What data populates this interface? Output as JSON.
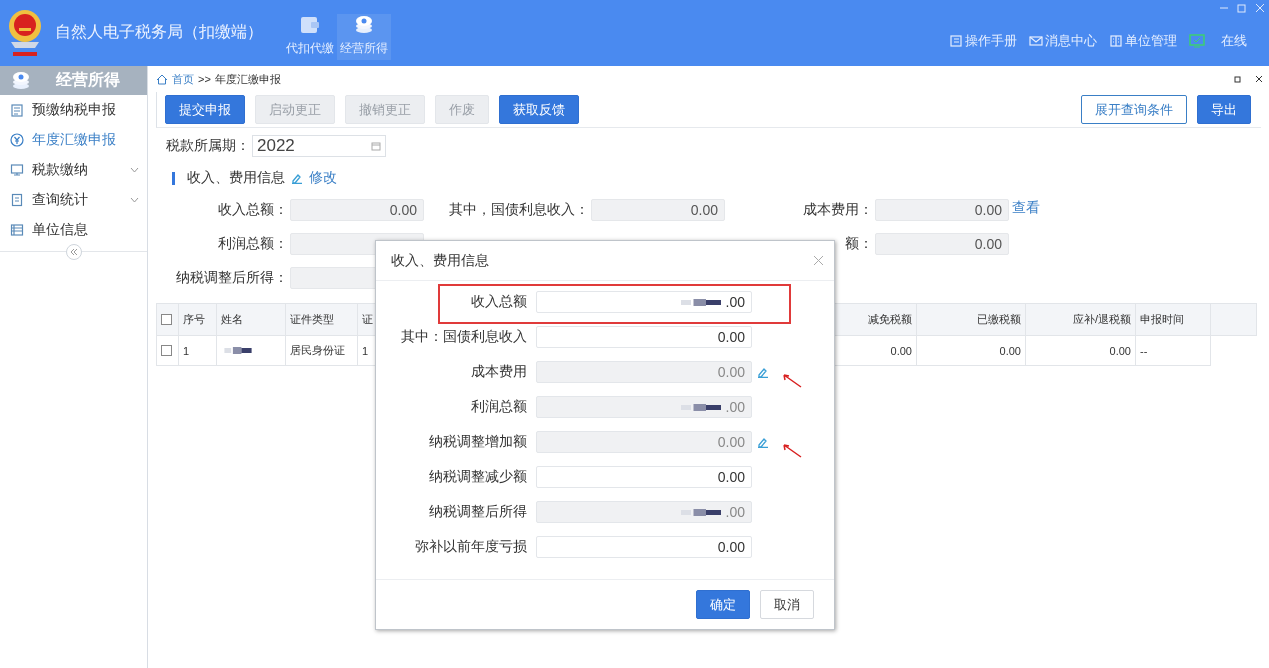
{
  "header": {
    "title": "自然人电子税务局（扣缴端）",
    "nav": [
      {
        "label": "代扣代缴",
        "selected": false
      },
      {
        "label": "经营所得",
        "selected": true
      }
    ],
    "links": [
      {
        "label": "操作手册"
      },
      {
        "label": "消息中心"
      },
      {
        "label": "单位管理"
      }
    ],
    "status": {
      "label": "在线",
      "online": true
    }
  },
  "sidebar": {
    "title": "经营所得",
    "items": [
      {
        "label": "预缴纳税申报",
        "selected": false,
        "expandable": false
      },
      {
        "label": "年度汇缴申报",
        "selected": true,
        "expandable": false
      },
      {
        "label": "税款缴纳",
        "selected": false,
        "expandable": true
      },
      {
        "label": "查询统计",
        "selected": false,
        "expandable": true
      },
      {
        "label": "单位信息",
        "selected": false,
        "expandable": false
      }
    ]
  },
  "breadcrumb": {
    "home": "首页",
    "separator": ">>",
    "current": "年度汇缴申报"
  },
  "toolbar": {
    "buttons": [
      {
        "label": "提交申报",
        "kind": "primary",
        "disabled": false
      },
      {
        "label": "启动更正",
        "kind": "default",
        "disabled": true
      },
      {
        "label": "撤销更正",
        "kind": "default",
        "disabled": true
      },
      {
        "label": "作废",
        "kind": "default",
        "disabled": true
      },
      {
        "label": "获取反馈",
        "kind": "primary",
        "disabled": false
      }
    ],
    "right_buttons": [
      {
        "label": "展开查询条件",
        "kind": "outline",
        "disabled": false
      },
      {
        "label": "导出",
        "kind": "primary",
        "disabled": false
      }
    ]
  },
  "period": {
    "label": "税款所属期：",
    "value": "2022"
  },
  "section": {
    "title": "收入、费用信息",
    "edit_link": "修改"
  },
  "field_columns": [
    [
      {
        "label": "收入总额：",
        "value": "0.00"
      },
      {
        "label": "利润总额："
      },
      {
        "label": "纳税调整后所得："
      }
    ],
    [
      {
        "label": "其中，国债利息收入：",
        "value": "0.00"
      }
    ],
    [
      {
        "label": "成本费用：",
        "value": "0.00",
        "link": "查看"
      },
      {
        "label": "额：",
        "value": "0.00"
      }
    ]
  ],
  "table": {
    "all_checked": false,
    "columns": [
      "序号",
      "姓名",
      "证件类型",
      "证",
      "减免税额",
      "已缴税额",
      "应补/退税额",
      "申报时间"
    ],
    "rows": [
      {
        "checked": false,
        "cells": [
          {
            "text": "1"
          },
          {
            "masked": true
          },
          {
            "text": "居民身份证"
          },
          {
            "text": "1"
          },
          {
            "text": "0.00"
          },
          {
            "text": "0.00"
          },
          {
            "text": "0.00"
          },
          {
            "text": "--"
          }
        ]
      }
    ]
  },
  "dialog": {
    "title": "收入、费用信息",
    "fields": [
      {
        "label": "收入总额",
        "value": ".00",
        "masked": true,
        "readonly": false,
        "highlighted": true,
        "editable": false
      },
      {
        "label": "其中：国债利息收入",
        "value": "0.00",
        "masked": false,
        "readonly": false,
        "highlighted": false,
        "editable": false
      },
      {
        "label": "成本费用",
        "value": "0.00",
        "masked": false,
        "readonly": true,
        "highlighted": false,
        "editable": true
      },
      {
        "label": "利润总额",
        "value": ".00",
        "masked": true,
        "readonly": true,
        "highlighted": false,
        "editable": false
      },
      {
        "label": "纳税调整增加额",
        "value": "0.00",
        "masked": false,
        "readonly": true,
        "highlighted": false,
        "editable": true
      },
      {
        "label": "纳税调整减少额",
        "value": "0.00",
        "masked": false,
        "readonly": false,
        "highlighted": false,
        "editable": false
      },
      {
        "label": "纳税调整后所得",
        "value": ".00",
        "masked": true,
        "readonly": true,
        "highlighted": false,
        "editable": false
      },
      {
        "label": "弥补以前年度亏损",
        "value": "0.00",
        "masked": false,
        "readonly": false,
        "highlighted": false,
        "editable": false
      }
    ],
    "buttons": [
      {
        "label": "确定",
        "kind": "primary"
      },
      {
        "label": "取消",
        "kind": "default"
      }
    ]
  }
}
